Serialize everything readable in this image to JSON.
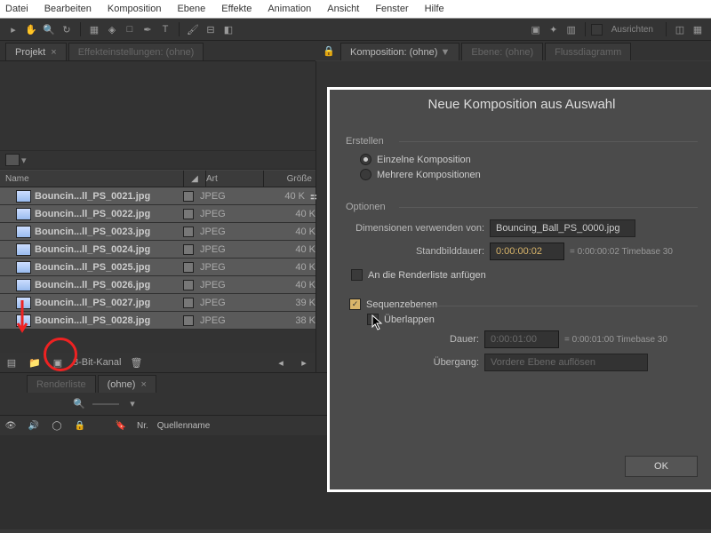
{
  "menu": {
    "items": [
      "Datei",
      "Bearbeiten",
      "Komposition",
      "Ebene",
      "Effekte",
      "Animation",
      "Ansicht",
      "Fenster",
      "Hilfe"
    ]
  },
  "toolbar": {
    "ausrichten": "Ausrichten"
  },
  "project_tab": {
    "label": "Projekt",
    "x": "×"
  },
  "effect_settings_tab": "Effekteinstellungen: (ohne)",
  "comp_viewer_tabs": {
    "comp": "Komposition: (ohne)",
    "layer": "Ebene: (ohne)",
    "flow": "Flussdiagramm"
  },
  "project_header": {
    "name": "Name",
    "art": "Art",
    "size": "Größe"
  },
  "files": [
    {
      "name": "Bouncin...ll_PS_0021.jpg",
      "art": "JPEG",
      "size": "40 K"
    },
    {
      "name": "Bouncin...ll_PS_0022.jpg",
      "art": "JPEG",
      "size": "40 K"
    },
    {
      "name": "Bouncin...ll_PS_0023.jpg",
      "art": "JPEG",
      "size": "40 K"
    },
    {
      "name": "Bouncin...ll_PS_0024.jpg",
      "art": "JPEG",
      "size": "40 K"
    },
    {
      "name": "Bouncin...ll_PS_0025.jpg",
      "art": "JPEG",
      "size": "40 K"
    },
    {
      "name": "Bouncin...ll_PS_0026.jpg",
      "art": "JPEG",
      "size": "40 K"
    },
    {
      "name": "Bouncin...ll_PS_0027.jpg",
      "art": "JPEG",
      "size": "39 K"
    },
    {
      "name": "Bouncin...ll_PS_0028.jpg",
      "art": "JPEG",
      "size": "38 K"
    }
  ],
  "bit_depth": "8-Bit-Kanal",
  "render_tab": "Renderliste",
  "none_tab": "(ohne)",
  "timeline": {
    "nr": "Nr.",
    "quelle": "Quellenname"
  },
  "dialog": {
    "title": "Neue Komposition aus Auswahl",
    "create": "Erstellen",
    "single": "Einzelne Komposition",
    "multi": "Mehrere Kompositionen",
    "options": "Optionen",
    "dims_from": "Dimensionen verwenden von:",
    "dims_value": "Bouncing_Ball_PS_0000.jpg",
    "still_dur": "Standbilddauer:",
    "still_time": "0:00:00:02",
    "still_note": "= 0:00:00:02  Timebase 30",
    "add_render": "An die Renderliste anfügen",
    "seq_layers": "Sequenzebenen",
    "overlap": "Überlappen",
    "duration": "Dauer:",
    "dur_time": "0:00:01:00",
    "dur_note": "= 0:00:01:00  Timebase 30",
    "transition": "Übergang:",
    "trans_value": "Vordere Ebene auflösen",
    "ok": "OK"
  }
}
